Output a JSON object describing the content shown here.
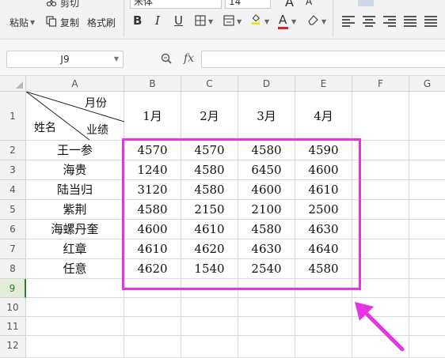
{
  "toolbar": {
    "paste_label": "粘贴",
    "cut_label": "剪切",
    "copy_label": "复制",
    "format_painter_label": "格式刷",
    "font_name": "宋体",
    "font_size": "14",
    "bold_label": "B",
    "italic_label": "I",
    "underline_label": "U",
    "grow_font_label": "A",
    "shrink_font_label": "A",
    "font_color_label": "A"
  },
  "formula_bar": {
    "name_box": "J9",
    "fx_label": "fx",
    "formula": ""
  },
  "columns": [
    "A",
    "B",
    "C",
    "D",
    "E",
    "F",
    "G"
  ],
  "rows": [
    "1",
    "2",
    "3",
    "4",
    "5",
    "6",
    "7",
    "8",
    "9",
    "10",
    "11",
    "12"
  ],
  "header_cell": {
    "top_label": "月份",
    "left_label": "姓名",
    "bottom_label": "业绩"
  },
  "month_headers": [
    "1月",
    "2月",
    "3月",
    "4月"
  ],
  "table": [
    {
      "name": "王一参",
      "values": [
        "4570",
        "4570",
        "4580",
        "4590"
      ]
    },
    {
      "name": "海贵",
      "values": [
        "1240",
        "4580",
        "6450",
        "4600"
      ]
    },
    {
      "name": "陆当归",
      "values": [
        "3120",
        "4580",
        "4600",
        "4610"
      ]
    },
    {
      "name": "紫荆",
      "values": [
        "4580",
        "2150",
        "2100",
        "2500"
      ]
    },
    {
      "name": "海螺丹奎",
      "values": [
        "4600",
        "4610",
        "4580",
        "4630"
      ]
    },
    {
      "name": "红章",
      "values": [
        "4610",
        "4620",
        "4630",
        "4640"
      ]
    },
    {
      "name": "任意",
      "values": [
        "4620",
        "1540",
        "2540",
        "4580"
      ]
    }
  ],
  "colors": {
    "highlight": "#e535e0",
    "arrow": "#e535e0",
    "active_row": "#2f7d32"
  }
}
